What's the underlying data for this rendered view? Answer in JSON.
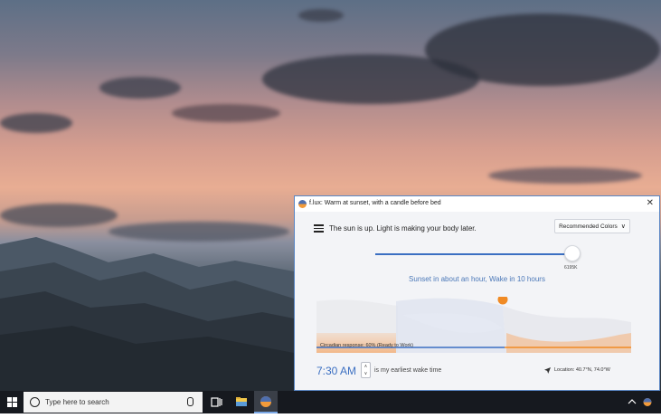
{
  "window": {
    "title": "f.lux: Warm at sunset, with a candle before bed",
    "status": "The sun is up. Light is making your body later.",
    "recommended_label": "Recommended Colors",
    "slider_value": "6195K",
    "sunset_text": "Sunset in about an hour, Wake in 10 hours",
    "circadian_label": "Circadian response: 60% (Ready to Work)",
    "wake_time": "7:30 AM",
    "wake_caption": "is my earliest wake time",
    "location": "Location: 40.7°N, 74.0°W",
    "slider_fraction": 0.95
  },
  "taskbar": {
    "search_placeholder": "Type here to search"
  },
  "colors": {
    "accent": "#3b6fc2",
    "orange": "#f08a24",
    "sunset_blue": "#4b78b8"
  },
  "icons": [
    "windows-icon",
    "search-icon",
    "microphone-icon",
    "task-view-icon",
    "file-explorer-icon",
    "flux-icon",
    "close-icon",
    "menu-icon",
    "chevron-down-icon",
    "location-arrow-icon",
    "chevron-up-icon"
  ]
}
